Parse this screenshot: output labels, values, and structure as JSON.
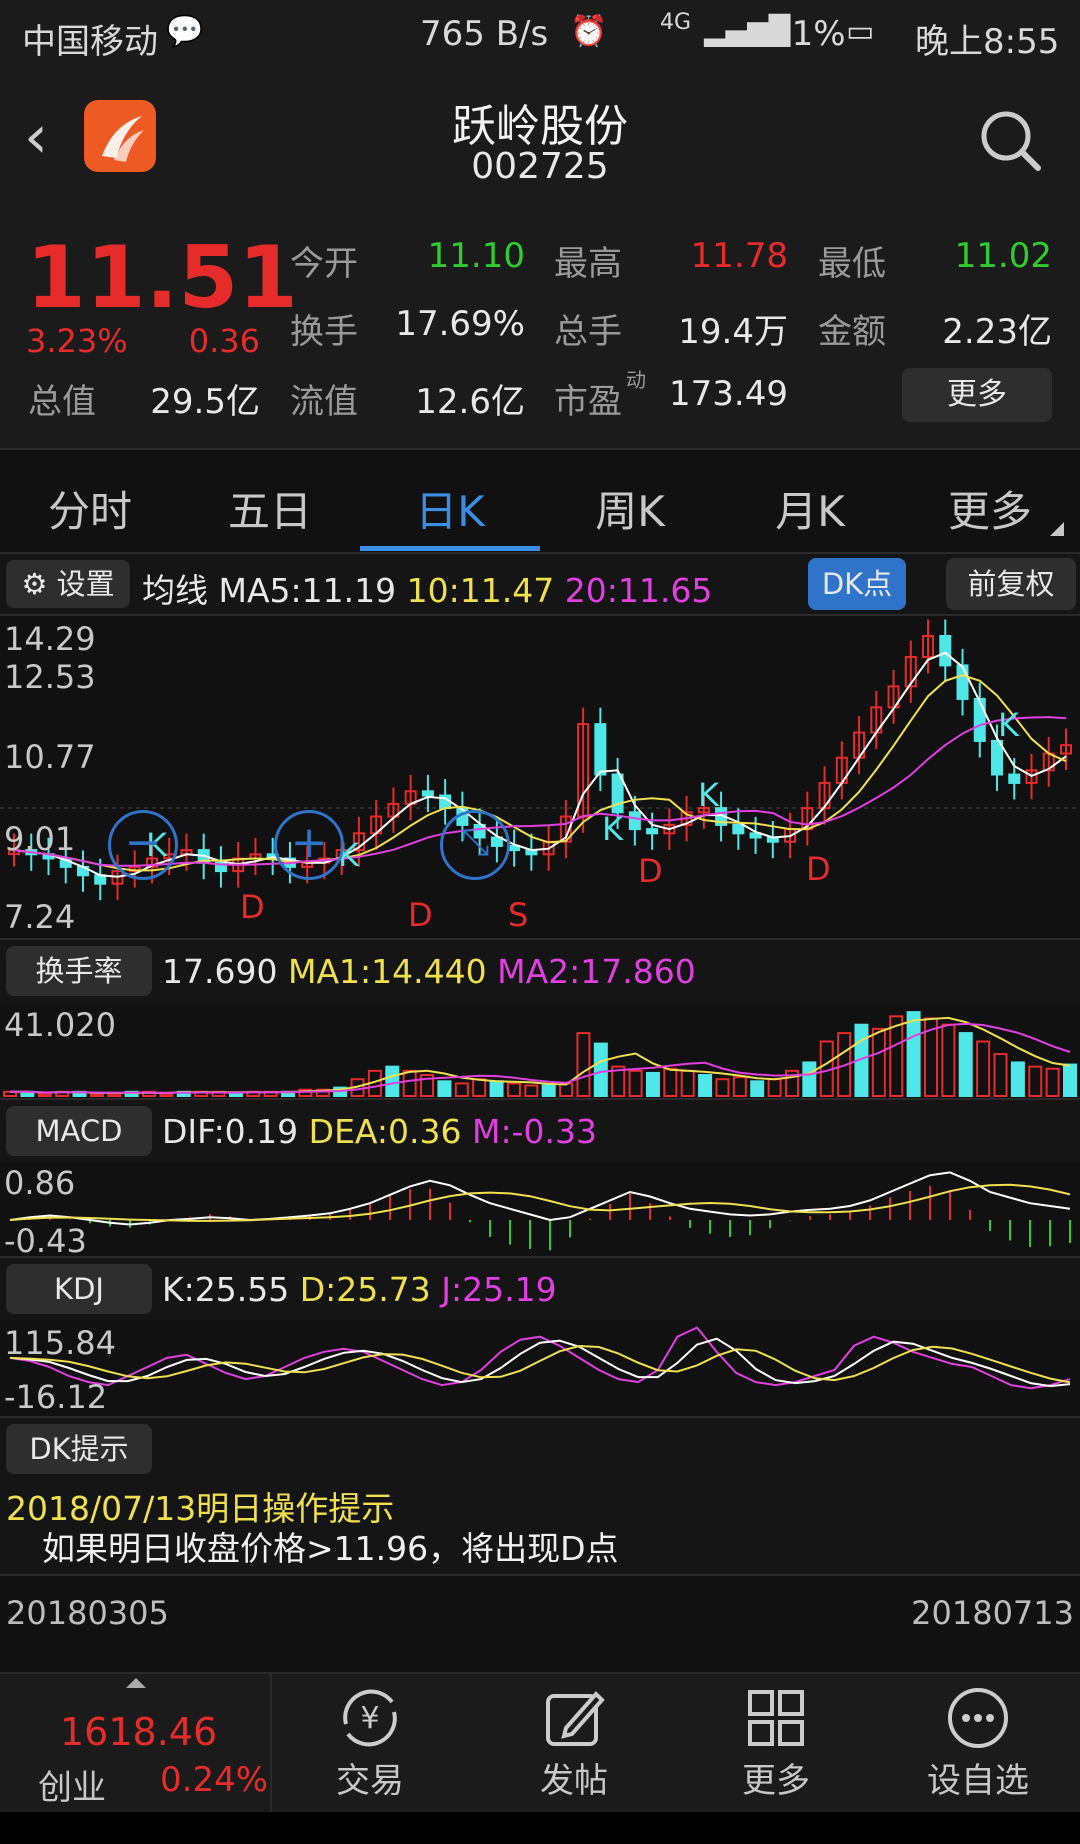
{
  "status_bar": {
    "carrier": "中国移动",
    "net_speed": "765 B/s",
    "signal": "4G",
    "battery": "71%",
    "time": "晚上8:55"
  },
  "header": {
    "stock_name": "跃岭股份",
    "stock_code": "002725"
  },
  "quote": {
    "price": "11.51",
    "change_pct": "3.23%",
    "change": "0.36",
    "total_value_label": "总值",
    "total_value": "29.5亿",
    "open_label": "今开",
    "open": "11.10",
    "high_label": "最高",
    "high": "11.78",
    "low_label": "最低",
    "low": "11.02",
    "turnover_label": "换手",
    "turnover": "17.69%",
    "volume_label": "总手",
    "volume": "19.4万",
    "amount_label": "金额",
    "amount": "2.23亿",
    "float_label": "流值",
    "float_value": "12.6亿",
    "pe_label": "市盈",
    "pe_sup": "动",
    "pe": "173.49",
    "more_label": "更多"
  },
  "tabs": [
    "分时",
    "五日",
    "日K",
    "周K",
    "月K",
    "更多"
  ],
  "active_tab": 2,
  "kline_toolbar": {
    "settings_label": "设置",
    "ma_prefix": "均线",
    "ma5": "MA5:11.19",
    "ma10": "10:11.47",
    "ma20": "20:11.65",
    "dk_label": "DK点",
    "fq_label": "前复权"
  },
  "kline_axis": [
    "14.29",
    "12.53",
    "10.77",
    "9.01",
    "7.24"
  ],
  "kline_markers": [
    "K",
    "D",
    "K",
    "D",
    "S",
    "K",
    "D",
    "K",
    "D",
    "K"
  ],
  "turnover_panel": {
    "label": "换手率",
    "value": "17.690",
    "ma1": "MA1:14.440",
    "ma2": "MA2:17.860",
    "axis_top": "41.020"
  },
  "macd_panel": {
    "label": "MACD",
    "dif": "DIF:0.19",
    "dea": "DEA:0.36",
    "m": "M:-0.33",
    "axis_top": "0.86",
    "axis_bottom": "-0.43"
  },
  "kdj_panel": {
    "label": "KDJ",
    "k": "K:25.55",
    "d": "D:25.73",
    "j": "J:25.19",
    "axis_top": "115.84",
    "axis_bottom": "-16.12"
  },
  "dk_tip": {
    "label": "DK提示",
    "title": "2018/07/13明日操作提示",
    "text": "如果明日收盘价格>11.96，将出现D点"
  },
  "date_range": {
    "start": "20180305",
    "end": "20180713"
  },
  "bottom_nav": {
    "index_value": "1618.46",
    "index_name": "创业",
    "index_pct": "0.24%",
    "items": [
      "交易",
      "发帖",
      "更多",
      "设自选"
    ]
  }
}
